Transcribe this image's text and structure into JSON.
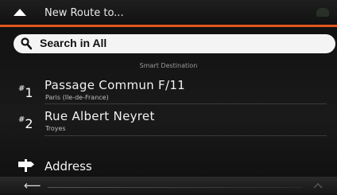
{
  "header": {
    "title": "New Route to...",
    "icon_up": "up-arrow-icon",
    "icon_status": "signal-icon",
    "accent_color": "#e0561f"
  },
  "search": {
    "label": "Search in All",
    "icon": "search-icon"
  },
  "section": {
    "label": "Smart Destination"
  },
  "destinations": [
    {
      "rank_prefix": "#",
      "rank": "1",
      "name": "Passage Commun F/11",
      "detail": "Paris (Ile-de-France)"
    },
    {
      "rank_prefix": "#",
      "rank": "2",
      "name": "Rue Albert Neyret",
      "detail": "Troyes"
    }
  ],
  "address": {
    "label": "Address",
    "icon": "signpost-icon"
  },
  "footer": {
    "back_icon": "back-arrow-icon",
    "back_glyph": "⟵"
  }
}
